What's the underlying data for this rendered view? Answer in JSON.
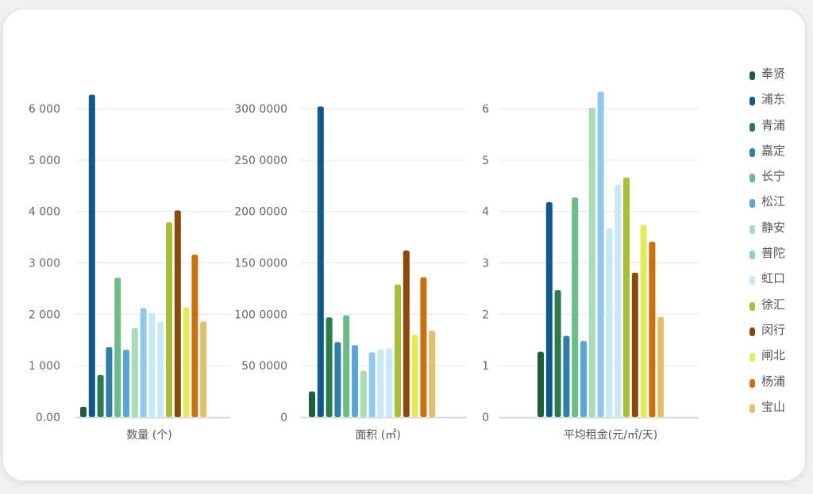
{
  "chart_data": [
    {
      "type": "bar",
      "xlabel": "数量 (个)",
      "ylabel": "",
      "ylim": [
        0,
        6000
      ],
      "yticks": [
        0,
        1000,
        2000,
        3000,
        4000,
        5000,
        6000
      ],
      "ytick_labels": [
        "0.00",
        "1 000",
        "2 000",
        "3 000",
        "4 000",
        "5 000",
        "6 000"
      ],
      "categories": [
        "奉贤",
        "浦东",
        "青浦",
        "嘉定",
        "长宁",
        "松江",
        "静安",
        "普陀",
        "虹口",
        "徐汇",
        "闵行",
        "闸北",
        "杨浦",
        "宝山"
      ],
      "values": [
        200,
        6270,
        820,
        1360,
        2710,
        1310,
        1730,
        2120,
        2020,
        1850,
        3790,
        4020,
        2130,
        3160,
        1860
      ]
    },
    {
      "type": "bar",
      "xlabel": "面积 (㎡)",
      "ylabel": "",
      "ylim": [
        0,
        3000000
      ],
      "yticks": [
        0,
        500000,
        1000000,
        1500000,
        2000000,
        2500000,
        3000000
      ],
      "ytick_labels": [
        "0",
        "50 0000",
        "100 0000",
        "150 0000",
        "200 0000",
        "250 0000",
        "300 0000"
      ],
      "categories": [
        "奉贤",
        "浦东",
        "青浦",
        "嘉定",
        "长宁",
        "松江",
        "静安",
        "普陀",
        "虹口",
        "徐汇",
        "闵行",
        "闸北",
        "杨浦",
        "宝山"
      ],
      "values": [
        250000,
        3020000,
        970000,
        730000,
        990000,
        700000,
        450000,
        630000,
        660000,
        670000,
        1290000,
        1620000,
        800000,
        1360000,
        840000
      ]
    },
    {
      "type": "bar",
      "xlabel": "平均租金(元/㎡/天)",
      "ylabel": "",
      "ylim": [
        0,
        6
      ],
      "yticks": [
        0,
        1,
        2,
        3,
        4,
        5,
        6
      ],
      "ytick_labels": [
        "0",
        "1",
        "2",
        "3",
        "4",
        "5",
        "6"
      ],
      "categories": [
        "奉贤",
        "浦东",
        "青浦",
        "嘉定",
        "长宁",
        "松江",
        "静安",
        "普陀",
        "虹口",
        "徐汇",
        "闵行",
        "闸北",
        "杨浦",
        "宝山"
      ],
      "values": [
        1.27,
        4.18,
        2.47,
        1.58,
        4.27,
        1.48,
        6.02,
        6.33,
        3.67,
        4.52,
        4.66,
        2.81,
        3.74,
        3.41,
        1.95
      ]
    }
  ],
  "legend": [
    {
      "label": "奉贤",
      "color": "#1f5c3b"
    },
    {
      "label": "浦东",
      "color": "#0d5a8a"
    },
    {
      "label": "青浦",
      "color": "#2e7a4f"
    },
    {
      "label": "嘉定",
      "color": "#2f7fa8"
    },
    {
      "label": "长宁",
      "color": "#6dbb85"
    },
    {
      "label": "松江",
      "color": "#5aa6d4"
    },
    {
      "label": "静安",
      "color": "#a8dcb4"
    },
    {
      "label": "普陀",
      "color": "#8ec9ec"
    },
    {
      "label": "虹口",
      "color": "#c8e8f4"
    },
    {
      "label": "徐汇",
      "color": "#a9bf3a"
    },
    {
      "label": "闵行",
      "color": "#8a4a0c"
    },
    {
      "label": "闸北",
      "color": "#e4ea5a"
    },
    {
      "label": "杨浦",
      "color": "#c9700f"
    },
    {
      "label": "宝山",
      "color": "#e2c06a"
    }
  ],
  "bar_colors": [
    "#1f5c3b",
    "#0d5a8a",
    "#2e7a4f",
    "#2f7fa8",
    "#6dbb85",
    "#5aa6d4",
    "#a8dcb4",
    "#8ec9ec",
    "#c8e8f4",
    "#c8e8f4",
    "#a9bf3a",
    "#8a4a0c",
    "#e4ea5a",
    "#c9700f",
    "#e2c06a"
  ],
  "grid": true
}
